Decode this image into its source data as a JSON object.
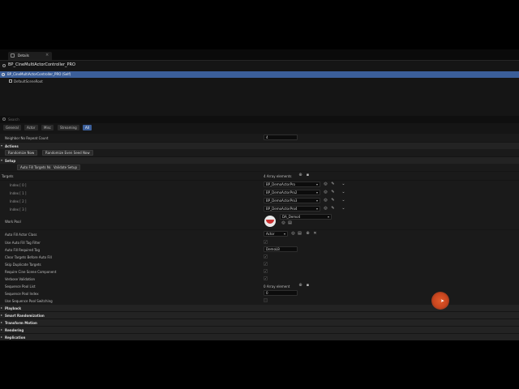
{
  "tab": {
    "label": "Details"
  },
  "header": {
    "title": "BP_CineMultiActorController_PRO"
  },
  "tree": {
    "selected": "BP_CineMultiActorController_PRO (Self)",
    "child": "DefaultSceneRoot"
  },
  "search": {
    "placeholder": "Search"
  },
  "filters": [
    {
      "label": "General"
    },
    {
      "label": "Actor"
    },
    {
      "label": "Misc"
    },
    {
      "label": "Streaming"
    },
    {
      "label": "All"
    }
  ],
  "props": {
    "neighbor": {
      "label": "Neighbor No Repeat Count",
      "value": "4"
    },
    "actions_cat": "Actions",
    "randomize_now": "Randomize Now",
    "randomize_new_seed": "Randomize Even Seed Now",
    "setup_cat": "Setup",
    "auto_fill": "Auto Fill Targets Now",
    "validate": "Validate Setup",
    "targets": {
      "label": "Targets",
      "count": "4 Array elements"
    },
    "indices": [
      {
        "label": "Index [ 0 ]",
        "value": "BP_DemoActorPro"
      },
      {
        "label": "Index [ 1 ]",
        "value": "BP_DemoActorPro2"
      },
      {
        "label": "Index [ 2 ]",
        "value": "BP_DemoActorPro3"
      },
      {
        "label": "Index [ 3 ]",
        "value": "BP_DemoActorPro4"
      }
    ],
    "work_pool": {
      "label": "Work Pool",
      "value": "DA_Demo4"
    },
    "auto_fill_class": {
      "label": "Auto Fill Actor Class",
      "value": "Actor"
    },
    "auto_fill_filter": "Use Auto Fill Tag Filter",
    "auto_fill_tag": {
      "label": "Auto Fill Required Tag",
      "value": "DemoLB"
    },
    "clear_targets": "Clear Targets Before Auto Fill",
    "skip_dupes": "Skip Duplicate Targets",
    "require_scene": "Require Cine Scene Component",
    "verbose": "Verbose Validation",
    "seq_pool": {
      "label": "Sequence Pool List",
      "count": "0 Array element"
    },
    "seq_index": {
      "label": "Sequence Pool Index",
      "value": "0"
    },
    "use_seq": "Use Sequence Pool Switching",
    "playback": "Playback",
    "smart_rand": "Smart Randomization",
    "transform": "Transform Motion",
    "rendering": "Rendering",
    "replication": "Replication"
  },
  "colors": {
    "selection": "#3b5e99",
    "background": "#151515",
    "cursor_highlight": "#e05a2a"
  }
}
